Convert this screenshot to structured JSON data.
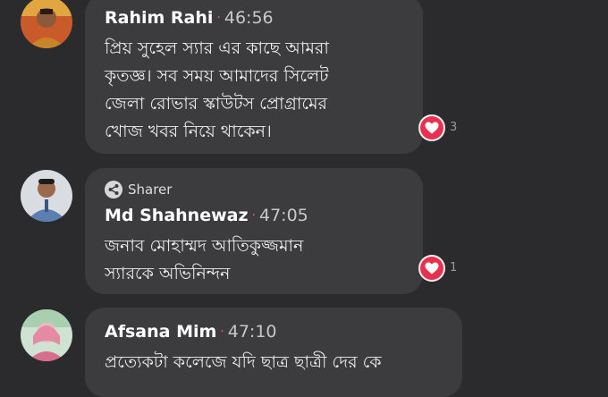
{
  "comments": [
    {
      "name": "Rahim Rahi",
      "time": "46:56",
      "lines": [
        "প্রিয় সুহেল স্যার এর কাছে আমরা",
        "কৃতজ্ঞ। সব সময় আমাদের সিলেট",
        "জেলা রোভার স্কাউটস প্রোগ্রামের",
        "খোজ খবর নিয়ে থাকেন।"
      ],
      "reaction_icon": "heart-icon",
      "reaction_count": "3"
    },
    {
      "badge": "Sharer",
      "badge_icon": "share-icon",
      "name": "Md Shahnewaz",
      "time": "47:05",
      "lines": [
        "জনাব মোহাম্মদ আতিকুজ্জমান",
        "স্যারকে অভিনিন্দন"
      ],
      "reaction_icon": "heart-icon",
      "reaction_count": "1"
    },
    {
      "name": "Afsana Mim",
      "time": "47:10",
      "lines": [
        "প্রত্যেকটা কলেজে যদি  ছাত্র ছাত্রী দের কে"
      ]
    }
  ],
  "separator": "·",
  "colors": {
    "background": "#2b2b2d",
    "bubble": "#3c3c3f",
    "reaction": "#e9304f",
    "separator_dot": "#e8675a"
  }
}
